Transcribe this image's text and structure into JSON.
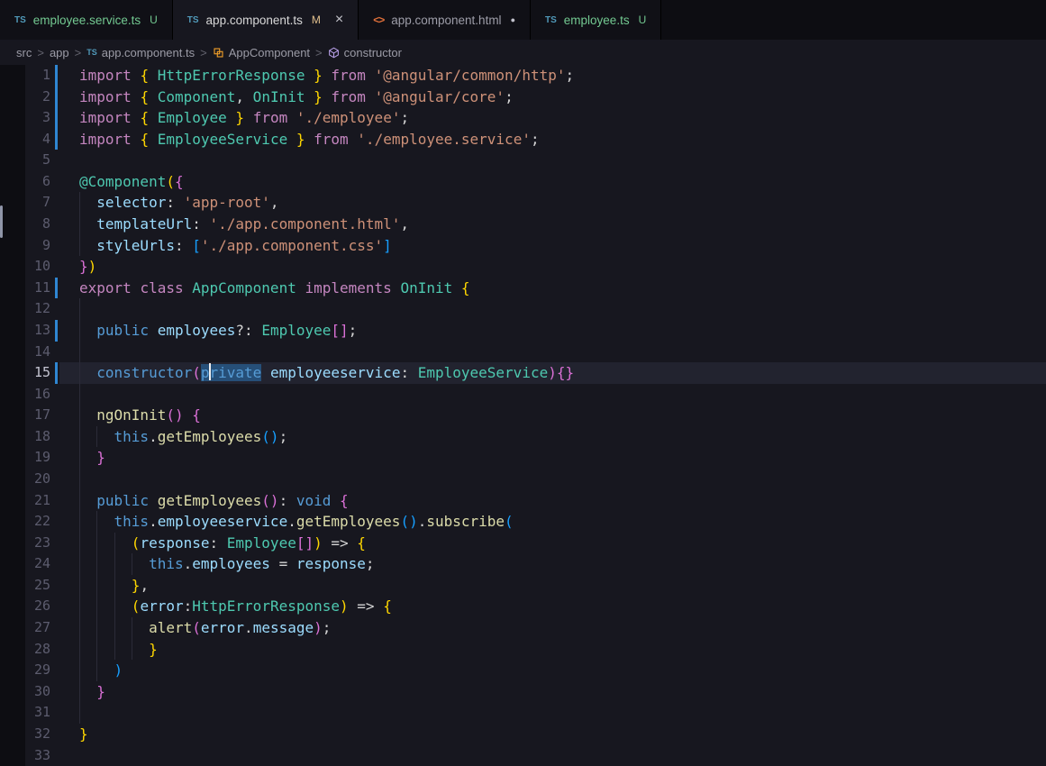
{
  "window": {
    "app": "Visual Studio Code",
    "view": "editor"
  },
  "colors": {
    "editor_background": "#17171f",
    "tabbar_background": "#0d0d12",
    "untracked_green": "#73C991",
    "modified_gold": "#E2C08D",
    "modified_gutter_blue": "#2f86d2",
    "selection_blue": "#264F78",
    "keyword_pink": "#C586C0",
    "keyword_blue": "#569CD6",
    "type_teal": "#4EC9B0",
    "string_orange": "#CE9178",
    "function_yellow": "#DCDCAA",
    "variable_blue": "#9CDCFE"
  },
  "tabs": [
    {
      "label": "employee.service.ts",
      "icon": "ts",
      "badge": "U",
      "state": "untracked",
      "active": false
    },
    {
      "label": "app.component.ts",
      "icon": "ts",
      "badge": "M",
      "state": "modified",
      "active": true,
      "close": "×"
    },
    {
      "label": "app.component.html",
      "icon": "html",
      "badge": "●",
      "state": "unsaved",
      "active": false
    },
    {
      "label": "employee.ts",
      "icon": "ts",
      "badge": "U",
      "state": "untracked",
      "active": false
    }
  ],
  "breadcrumbs": {
    "separator": ">",
    "items": [
      {
        "label": "src",
        "icon": "none"
      },
      {
        "label": "app",
        "icon": "none"
      },
      {
        "label": "app.component.ts",
        "icon": "ts"
      },
      {
        "label": "AppComponent",
        "icon": "class"
      },
      {
        "label": "constructor",
        "icon": "method"
      }
    ]
  },
  "editor": {
    "language": "typescript",
    "active_line": 15,
    "lines": [
      {
        "n": 1,
        "g": 0,
        "ch": true,
        "t": [
          [
            "import ",
            "kw"
          ],
          [
            "{",
            "b1"
          ],
          [
            " HttpErrorResponse ",
            "type"
          ],
          [
            "}",
            "b1"
          ],
          [
            " ",
            "pn"
          ],
          [
            "from ",
            "kw"
          ],
          [
            "'@angular/common/http'",
            "str"
          ],
          [
            ";",
            "pn"
          ]
        ]
      },
      {
        "n": 2,
        "g": 0,
        "ch": true,
        "t": [
          [
            "import ",
            "kw"
          ],
          [
            "{",
            "b1"
          ],
          [
            " Component",
            "type"
          ],
          [
            ",",
            "pn"
          ],
          [
            " OnInit ",
            "type"
          ],
          [
            "}",
            "b1"
          ],
          [
            " ",
            "pn"
          ],
          [
            "from ",
            "kw"
          ],
          [
            "'@angular/core'",
            "str"
          ],
          [
            ";",
            "pn"
          ]
        ]
      },
      {
        "n": 3,
        "g": 0,
        "ch": true,
        "t": [
          [
            "import ",
            "kw"
          ],
          [
            "{",
            "b1"
          ],
          [
            " Employee ",
            "type"
          ],
          [
            "}",
            "b1"
          ],
          [
            " ",
            "pn"
          ],
          [
            "from ",
            "kw"
          ],
          [
            "'./employee'",
            "str"
          ],
          [
            ";",
            "pn"
          ]
        ]
      },
      {
        "n": 4,
        "g": 0,
        "ch": true,
        "t": [
          [
            "import ",
            "kw"
          ],
          [
            "{",
            "b1"
          ],
          [
            " EmployeeService ",
            "type"
          ],
          [
            "}",
            "b1"
          ],
          [
            " ",
            "pn"
          ],
          [
            "from ",
            "kw"
          ],
          [
            "'./employee.service'",
            "str"
          ],
          [
            ";",
            "pn"
          ]
        ]
      },
      {
        "n": 5,
        "g": 0,
        "ch": false,
        "t": []
      },
      {
        "n": 6,
        "g": 0,
        "ch": false,
        "t": [
          [
            "@Component",
            "type"
          ],
          [
            "(",
            "b1"
          ],
          [
            "{",
            "b2"
          ]
        ]
      },
      {
        "n": 7,
        "g": 1,
        "ch": false,
        "t": [
          [
            "  ",
            "pn"
          ],
          [
            "selector",
            "var"
          ],
          [
            ": ",
            "pn"
          ],
          [
            "'app-root'",
            "str"
          ],
          [
            ",",
            "pn"
          ]
        ]
      },
      {
        "n": 8,
        "g": 1,
        "ch": false,
        "t": [
          [
            "  ",
            "pn"
          ],
          [
            "templateUrl",
            "var"
          ],
          [
            ": ",
            "pn"
          ],
          [
            "'./app.component.html'",
            "str"
          ],
          [
            ",",
            "pn"
          ]
        ]
      },
      {
        "n": 9,
        "g": 1,
        "ch": false,
        "t": [
          [
            "  ",
            "pn"
          ],
          [
            "styleUrls",
            "var"
          ],
          [
            ": ",
            "pn"
          ],
          [
            "[",
            "b3"
          ],
          [
            "'./app.component.css'",
            "str"
          ],
          [
            "]",
            "b3"
          ]
        ]
      },
      {
        "n": 10,
        "g": 0,
        "ch": false,
        "t": [
          [
            "}",
            "b2"
          ],
          [
            ")",
            "b1"
          ]
        ]
      },
      {
        "n": 11,
        "g": 0,
        "ch": true,
        "t": [
          [
            "export ",
            "kw"
          ],
          [
            "class ",
            "kw"
          ],
          [
            "AppComponent ",
            "type"
          ],
          [
            "implements ",
            "kw"
          ],
          [
            "OnInit ",
            "type"
          ],
          [
            "{",
            "b1"
          ]
        ]
      },
      {
        "n": 12,
        "g": 1,
        "ch": false,
        "t": []
      },
      {
        "n": 13,
        "g": 1,
        "ch": true,
        "t": [
          [
            "  ",
            "pn"
          ],
          [
            "public ",
            "kw2"
          ],
          [
            "employees",
            "var"
          ],
          [
            "?: ",
            "pn"
          ],
          [
            "Employee",
            "type"
          ],
          [
            "[]",
            "b2"
          ],
          [
            ";",
            "pn"
          ]
        ]
      },
      {
        "n": 14,
        "g": 1,
        "ch": false,
        "t": []
      },
      {
        "n": 15,
        "g": 1,
        "ch": true,
        "t": [
          [
            "  ",
            "pn"
          ],
          [
            "constructor",
            "kw2"
          ],
          [
            "(",
            "b2"
          ],
          [
            "p",
            "kw2 sel"
          ],
          [
            "",
            "cursor"
          ],
          [
            "rivate",
            "kw2 sel"
          ],
          [
            " ",
            "pn"
          ],
          [
            "employeeservice",
            "var"
          ],
          [
            ": ",
            "pn"
          ],
          [
            "EmployeeService",
            "type"
          ],
          [
            ")",
            "b2"
          ],
          [
            "{}",
            "b2"
          ]
        ]
      },
      {
        "n": 16,
        "g": 1,
        "ch": false,
        "t": []
      },
      {
        "n": 17,
        "g": 1,
        "ch": false,
        "t": [
          [
            "  ",
            "pn"
          ],
          [
            "ngOnInit",
            "fn"
          ],
          [
            "()",
            "b2"
          ],
          [
            " ",
            "pn"
          ],
          [
            "{",
            "b2"
          ]
        ]
      },
      {
        "n": 18,
        "g": 2,
        "ch": false,
        "t": [
          [
            "    ",
            "pn"
          ],
          [
            "this",
            "kw2"
          ],
          [
            ".",
            "pn"
          ],
          [
            "getEmployees",
            "fn"
          ],
          [
            "()",
            "b3"
          ],
          [
            ";",
            "pn"
          ]
        ]
      },
      {
        "n": 19,
        "g": 1,
        "ch": false,
        "t": [
          [
            "  ",
            "pn"
          ],
          [
            "}",
            "b2"
          ]
        ]
      },
      {
        "n": 20,
        "g": 1,
        "ch": false,
        "t": []
      },
      {
        "n": 21,
        "g": 1,
        "ch": false,
        "t": [
          [
            "  ",
            "pn"
          ],
          [
            "public ",
            "kw2"
          ],
          [
            "getEmployees",
            "fn"
          ],
          [
            "()",
            "b2"
          ],
          [
            ": ",
            "pn"
          ],
          [
            "void ",
            "kw2"
          ],
          [
            "{",
            "b2"
          ]
        ]
      },
      {
        "n": 22,
        "g": 2,
        "ch": false,
        "t": [
          [
            "    ",
            "pn"
          ],
          [
            "this",
            "kw2"
          ],
          [
            ".",
            "pn"
          ],
          [
            "employeeservice",
            "var"
          ],
          [
            ".",
            "pn"
          ],
          [
            "getEmployees",
            "fn"
          ],
          [
            "()",
            "b3"
          ],
          [
            ".",
            "pn"
          ],
          [
            "subscribe",
            "fn"
          ],
          [
            "(",
            "b3"
          ]
        ]
      },
      {
        "n": 23,
        "g": 3,
        "ch": false,
        "t": [
          [
            "      ",
            "pn"
          ],
          [
            "(",
            "b1"
          ],
          [
            "response",
            "var"
          ],
          [
            ": ",
            "pn"
          ],
          [
            "Employee",
            "type"
          ],
          [
            "[]",
            "b2"
          ],
          [
            ")",
            "b1"
          ],
          [
            " => ",
            "pn"
          ],
          [
            "{",
            "b1"
          ]
        ]
      },
      {
        "n": 24,
        "g": 4,
        "ch": false,
        "t": [
          [
            "        ",
            "pn"
          ],
          [
            "this",
            "kw2"
          ],
          [
            ".",
            "pn"
          ],
          [
            "employees",
            "var"
          ],
          [
            " = ",
            "pn"
          ],
          [
            "response",
            "var"
          ],
          [
            ";",
            "pn"
          ]
        ]
      },
      {
        "n": 25,
        "g": 3,
        "ch": false,
        "t": [
          [
            "      ",
            "pn"
          ],
          [
            "}",
            "b1"
          ],
          [
            ",",
            "pn"
          ]
        ]
      },
      {
        "n": 26,
        "g": 3,
        "ch": false,
        "t": [
          [
            "      ",
            "pn"
          ],
          [
            "(",
            "b1"
          ],
          [
            "error",
            "var"
          ],
          [
            ":",
            "pn"
          ],
          [
            "HttpErrorResponse",
            "type"
          ],
          [
            ")",
            "b1"
          ],
          [
            " => ",
            "pn"
          ],
          [
            "{",
            "b1"
          ]
        ]
      },
      {
        "n": 27,
        "g": 4,
        "ch": false,
        "t": [
          [
            "        ",
            "pn"
          ],
          [
            "alert",
            "fn"
          ],
          [
            "(",
            "b2"
          ],
          [
            "error",
            "var"
          ],
          [
            ".",
            "pn"
          ],
          [
            "message",
            "var"
          ],
          [
            ")",
            "b2"
          ],
          [
            ";",
            "pn"
          ]
        ]
      },
      {
        "n": 28,
        "g": 4,
        "ch": false,
        "t": [
          [
            "        ",
            "pn"
          ],
          [
            "}",
            "b1"
          ]
        ]
      },
      {
        "n": 29,
        "g": 2,
        "ch": false,
        "t": [
          [
            "    ",
            "pn"
          ],
          [
            ")",
            "b3"
          ]
        ]
      },
      {
        "n": 30,
        "g": 1,
        "ch": false,
        "t": [
          [
            "  ",
            "pn"
          ],
          [
            "}",
            "b2"
          ]
        ]
      },
      {
        "n": 31,
        "g": 1,
        "ch": false,
        "t": []
      },
      {
        "n": 32,
        "g": 0,
        "ch": false,
        "t": [
          [
            "}",
            "b1"
          ]
        ]
      },
      {
        "n": 33,
        "g": 0,
        "ch": false,
        "t": []
      }
    ]
  }
}
